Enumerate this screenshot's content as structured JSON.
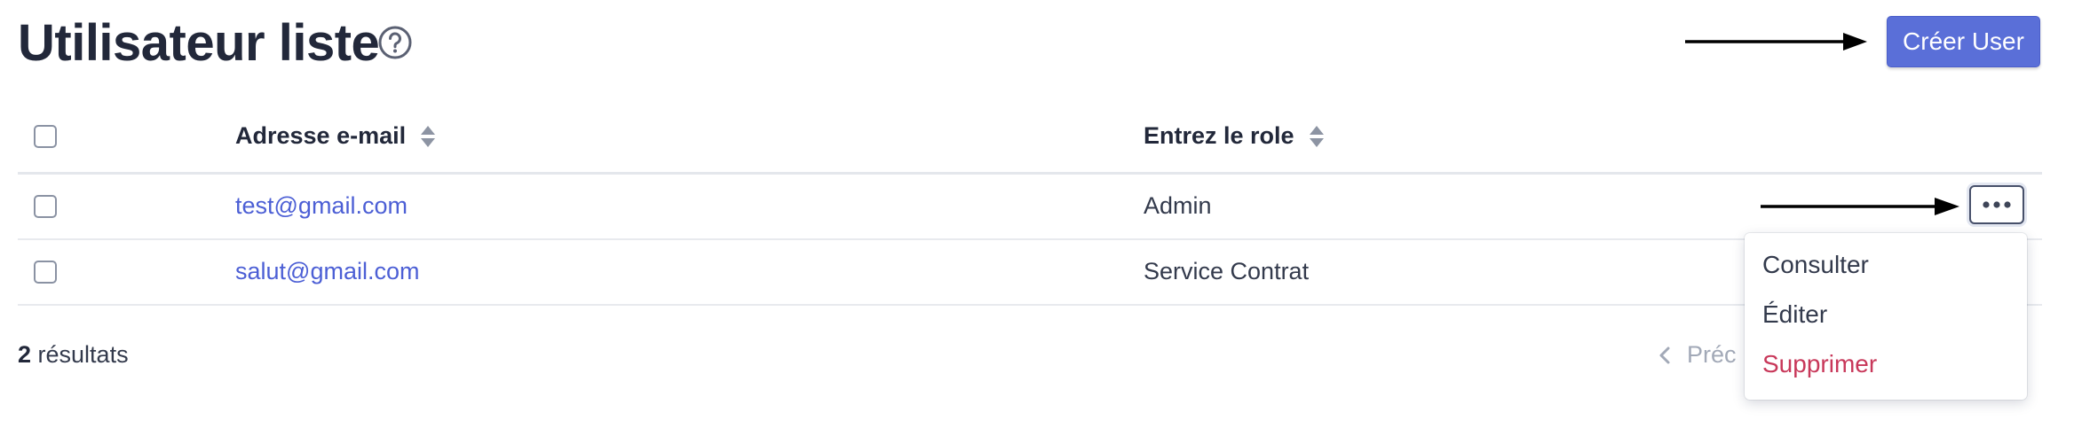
{
  "header": {
    "title": "Utilisateur liste",
    "create_button_label": "Créer User"
  },
  "table": {
    "columns": [
      {
        "label": "Adresse e-mail",
        "sortable": true
      },
      {
        "label": "Entrez le role",
        "sortable": true
      }
    ],
    "rows": [
      {
        "email": "test@gmail.com",
        "role": "Admin"
      },
      {
        "email": "salut@gmail.com",
        "role": "Service Contrat"
      }
    ]
  },
  "footer": {
    "count": "2",
    "count_suffix": " résultats",
    "prev_label": "Préc"
  },
  "row_menu": {
    "items": [
      {
        "label": "Consulter"
      },
      {
        "label": "Éditer"
      },
      {
        "label": "Supprimer",
        "danger": true
      }
    ]
  },
  "colors": {
    "primary": "#5a6fd8",
    "link": "#4c5fd5",
    "danger": "#c8385a",
    "text": "#22283a"
  }
}
